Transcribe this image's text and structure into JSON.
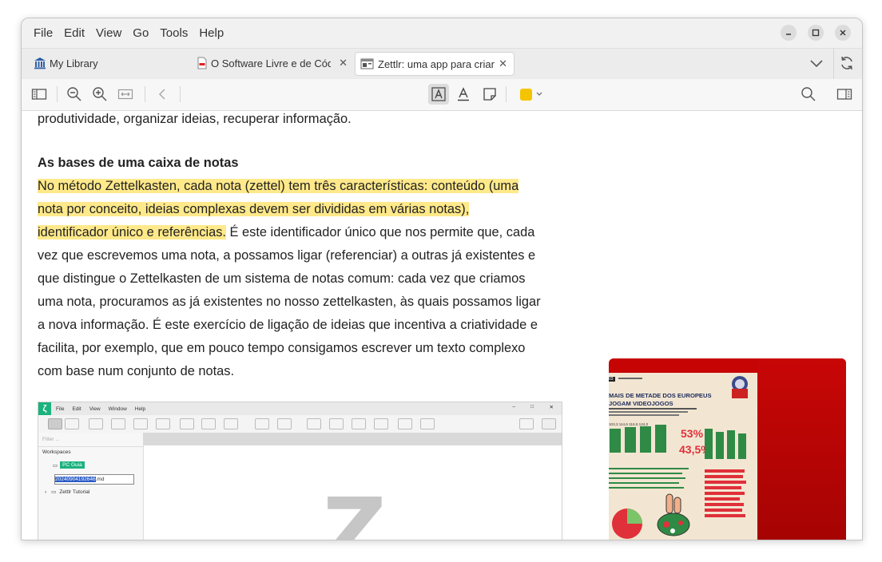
{
  "menu": [
    "File",
    "Edit",
    "View",
    "Go",
    "Tools",
    "Help"
  ],
  "window_controls": {
    "minimize": "minimize-icon",
    "maximize": "maximize-icon",
    "close": "close-icon"
  },
  "tabs": [
    {
      "label": "My Library",
      "icon": "library-icon"
    },
    {
      "label": "O Software Livre e de Cód",
      "icon": "pdf-icon"
    },
    {
      "label": "Zettlr: uma app para criar",
      "icon": "snapshot-icon",
      "active": true
    }
  ],
  "highlight_color": "#f5c400",
  "article": {
    "line_0": "produtividade, organizar ideias, recuperar informação.",
    "heading": "As bases de uma caixa de notas",
    "hl_1": "No método Zettelkasten, cada nota (zettel) tem três características: conteúdo (uma",
    "hl_2": "nota por conceito, ideias complexas devem ser divididas em várias notas),",
    "hl_3": "identificador único e referências.",
    "rest_3": " É este identificador único que nos permite que, cada",
    "line_4": "vez que escrevemos uma nota, a possamos ligar (referenciar) a outras já existentes e",
    "line_5": "que distingue o Zettelkasten de um sistema de notas comum: cada vez que criamos",
    "line_6": "uma nota, procuramos as já existentes no nosso zettelkasten, às quais possamos ligar",
    "line_7": "a nova informação. É este exercício de ligação de ideias que incentiva a criatividade e",
    "line_8": "facilita, por exemplo, que em pouco tempo consigamos escrever um texto complexo",
    "line_9": "com base num conjunto de notas."
  },
  "embedded_screenshot": {
    "menu": [
      "File",
      "Edit",
      "View",
      "Window",
      "Help"
    ],
    "filter_placeholder": "Filter ...",
    "workspaces_label": "Workspaces",
    "folder_pc": "PC Guia",
    "file_name": "20240904192646",
    "file_ext": ".md",
    "tutorial": "Zettlr Tutorial",
    "logo_letter": "Z"
  },
  "side_image": {
    "badge": "03",
    "headline_1": "MAIS DE METADE DOS EUROPEUS",
    "headline_2": "JOGAM VIDEOJOGOS",
    "stat_1": "53%",
    "stat_2": "43,5%",
    "bar_values": [
      "103,3",
      "114,6",
      "116,5",
      "124,0"
    ]
  }
}
